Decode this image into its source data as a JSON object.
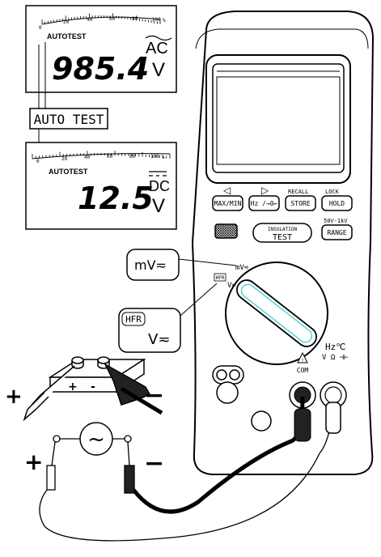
{
  "display_top": {
    "scale_ticks": [
      "0",
      "20",
      "40",
      "60",
      "80",
      "100",
      "%"
    ],
    "mode_label": "AUTOTEST",
    "reading": "985.4",
    "unit_mode": "AC",
    "unit": "V"
  },
  "auto_test_label": "AUTO TEST",
  "display_bottom": {
    "scale_ticks": [
      "0",
      "20",
      "40",
      "60",
      "80",
      "100",
      "%"
    ],
    "mode_label": "AUTOTEST",
    "reading": "12.5",
    "unit_mode": "DC",
    "unit": "V"
  },
  "meter": {
    "arrow_left": "◁",
    "arrow_right": "▷",
    "recall_label": "RECALL",
    "lock_label": "LOCK",
    "buttons": {
      "max_min": "MAX/MIN",
      "hz": "Hz /→0←",
      "store": "STORE",
      "hold": "HOLD",
      "insulation_line1": "INSULATION",
      "insulation_line2": "TEST",
      "range_top": "50V-1kV",
      "range": "RANGE"
    },
    "dial": {
      "mv_label": "mV≂",
      "hfr_label": "HFR",
      "v_label": "V≂"
    },
    "terminals": {
      "com": "COM",
      "hz_top": "Hz℃",
      "v_ohm": "V Ω ⊣⊢"
    }
  },
  "callouts": {
    "mv": "mV≂",
    "hfr": "HFR",
    "v": "V≂"
  },
  "battery": {
    "plus": "+",
    "minus": "-"
  },
  "probe_signs": {
    "battery_plus": "+",
    "battery_minus": "−",
    "source_plus": "+",
    "source_minus": "−"
  },
  "source_symbol": "~"
}
